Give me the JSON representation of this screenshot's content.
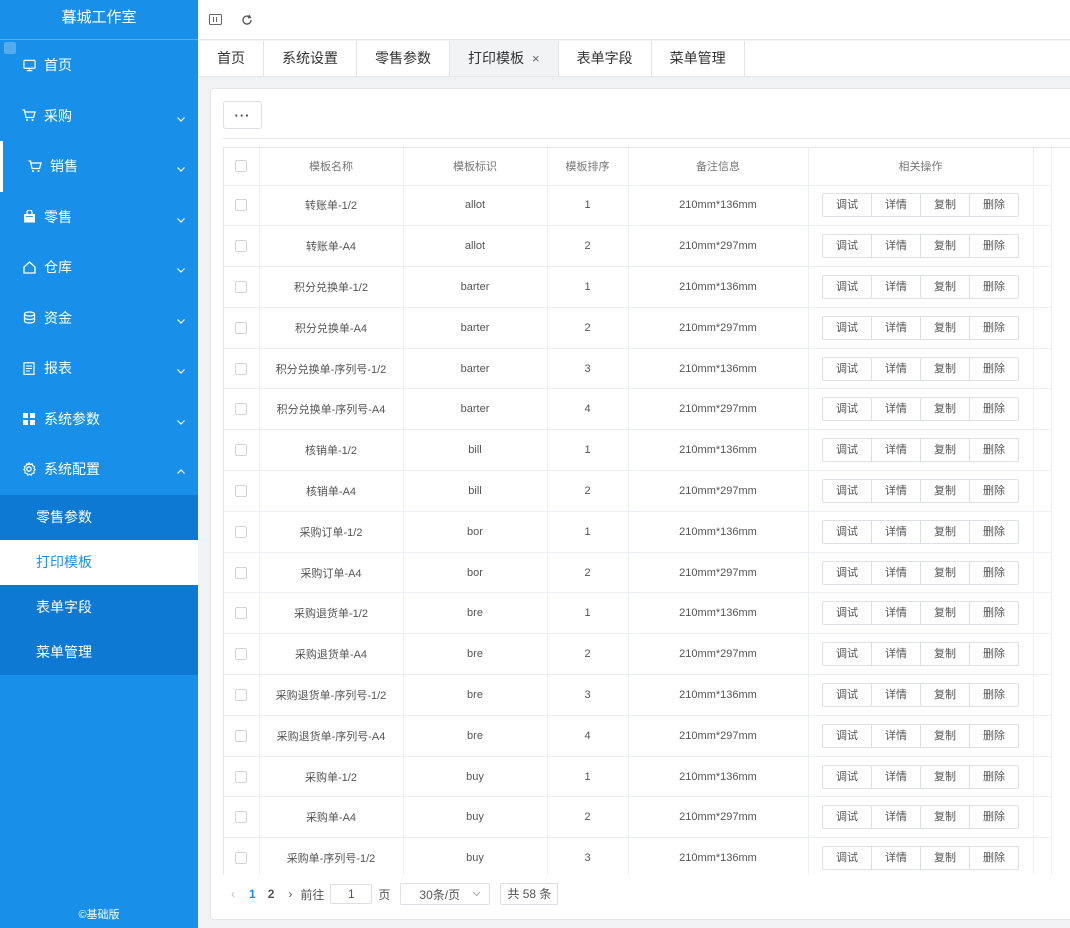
{
  "sidebar": {
    "brand": "暮城工作室",
    "items": [
      {
        "label": "首页",
        "icon": "monitor-icon",
        "expandable": false
      },
      {
        "label": "采购",
        "icon": "cart-icon",
        "expandable": true
      },
      {
        "label": "销售",
        "icon": "cart-icon",
        "expandable": true
      },
      {
        "label": "零售",
        "icon": "bag-icon",
        "expandable": true
      },
      {
        "label": "仓库",
        "icon": "home-icon",
        "expandable": true
      },
      {
        "label": "资金",
        "icon": "database-icon",
        "expandable": true
      },
      {
        "label": "报表",
        "icon": "document-icon",
        "expandable": true
      },
      {
        "label": "系统参数",
        "icon": "grid-icon",
        "expandable": true
      },
      {
        "label": "系统配置",
        "icon": "gear-icon",
        "expandable": true
      }
    ],
    "submenu": [
      {
        "label": "零售参数"
      },
      {
        "label": "打印模板",
        "active": true
      },
      {
        "label": "表单字段"
      },
      {
        "label": "菜单管理"
      }
    ],
    "footer": "©基础版"
  },
  "tabs": [
    {
      "label": "首页"
    },
    {
      "label": "系统设置"
    },
    {
      "label": "零售参数"
    },
    {
      "label": "打印模板",
      "active": true,
      "closable": true,
      "close": "×"
    },
    {
      "label": "表单字段"
    },
    {
      "label": "菜单管理"
    }
  ],
  "toolbar": {
    "more_label": "···"
  },
  "table": {
    "columns": [
      "模板名称",
      "模板标识",
      "模板排序",
      "备注信息",
      "相关操作"
    ],
    "actions": [
      "调试",
      "详情",
      "复制",
      "删除"
    ],
    "rows": [
      {
        "name": "转账单-1/2",
        "key": "allot",
        "sort": "1",
        "note": "210mm*136mm"
      },
      {
        "name": "转账单-A4",
        "key": "allot",
        "sort": "2",
        "note": "210mm*297mm"
      },
      {
        "name": "积分兑换单-1/2",
        "key": "barter",
        "sort": "1",
        "note": "210mm*136mm"
      },
      {
        "name": "积分兑换单-A4",
        "key": "barter",
        "sort": "2",
        "note": "210mm*297mm"
      },
      {
        "name": "积分兑换单-序列号-1/2",
        "key": "barter",
        "sort": "3",
        "note": "210mm*136mm"
      },
      {
        "name": "积分兑换单-序列号-A4",
        "key": "barter",
        "sort": "4",
        "note": "210mm*297mm"
      },
      {
        "name": "核销单-1/2",
        "key": "bill",
        "sort": "1",
        "note": "210mm*136mm"
      },
      {
        "name": "核销单-A4",
        "key": "bill",
        "sort": "2",
        "note": "210mm*297mm"
      },
      {
        "name": "采购订单-1/2",
        "key": "bor",
        "sort": "1",
        "note": "210mm*136mm"
      },
      {
        "name": "采购订单-A4",
        "key": "bor",
        "sort": "2",
        "note": "210mm*297mm"
      },
      {
        "name": "采购退货单-1/2",
        "key": "bre",
        "sort": "1",
        "note": "210mm*136mm"
      },
      {
        "name": "采购退货单-A4",
        "key": "bre",
        "sort": "2",
        "note": "210mm*297mm"
      },
      {
        "name": "采购退货单-序列号-1/2",
        "key": "bre",
        "sort": "3",
        "note": "210mm*136mm"
      },
      {
        "name": "采购退货单-序列号-A4",
        "key": "bre",
        "sort": "4",
        "note": "210mm*297mm"
      },
      {
        "name": "采购单-1/2",
        "key": "buy",
        "sort": "1",
        "note": "210mm*136mm"
      },
      {
        "name": "采购单-A4",
        "key": "buy",
        "sort": "2",
        "note": "210mm*297mm"
      },
      {
        "name": "采购单-序列号-1/2",
        "key": "buy",
        "sort": "3",
        "note": "210mm*136mm"
      }
    ]
  },
  "pagination": {
    "pages": [
      "1",
      "2"
    ],
    "current": "1",
    "goto_prefix": "前往",
    "goto_value": "1",
    "goto_suffix": "页",
    "page_size": "30条/页",
    "total": "共 58 条"
  },
  "colors": {
    "accent": "#1890e9",
    "submenu_bg": "#0e79d3"
  }
}
